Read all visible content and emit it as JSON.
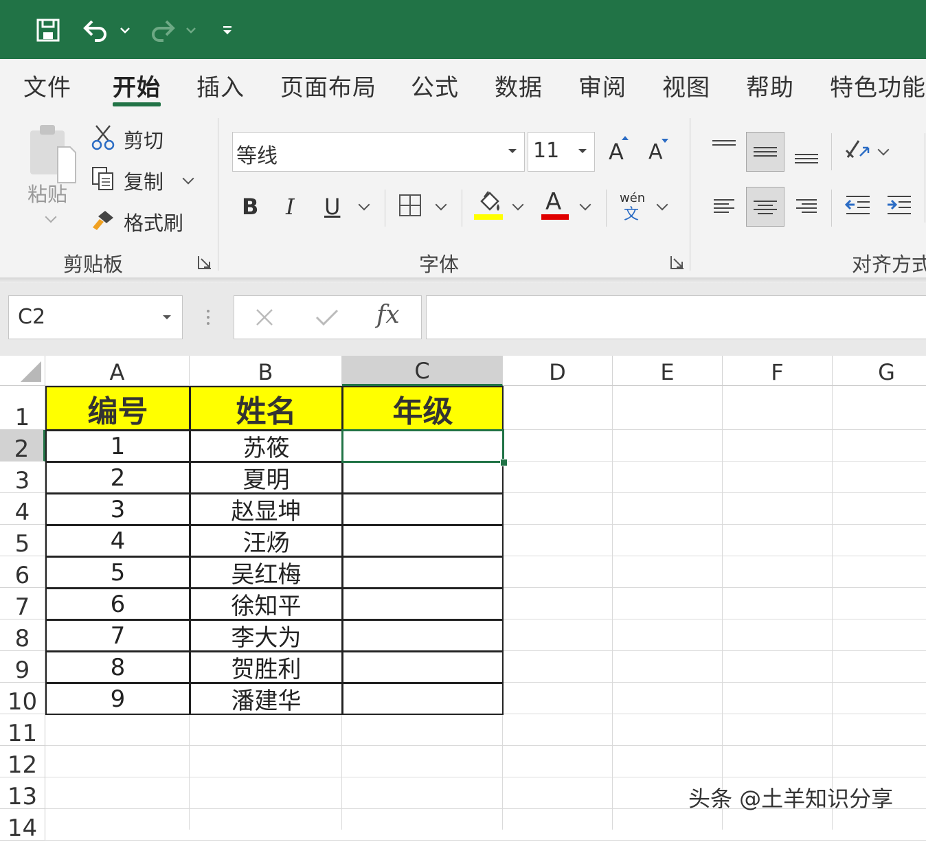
{
  "colors": {
    "brand": "#217346",
    "header_fill": "#ffff00",
    "fill_color_bar": "#ffff00",
    "font_color_bar": "#e00000"
  },
  "quick_access": {
    "icons": [
      "save-icon",
      "undo-icon",
      "redo-icon",
      "customize-icon"
    ]
  },
  "menu": {
    "tabs": [
      "文件",
      "开始",
      "插入",
      "页面布局",
      "公式",
      "数据",
      "审阅",
      "视图",
      "帮助",
      "特色功能"
    ],
    "active": "开始"
  },
  "ribbon": {
    "clipboard": {
      "paste": "粘贴",
      "cut": "剪切",
      "copy": "复制",
      "format_painter": "格式刷",
      "group_label": "剪贴板"
    },
    "font": {
      "font_name": "等线",
      "font_size": "11",
      "bold": "B",
      "italic": "I",
      "underline": "U",
      "grow": "A",
      "shrink": "A",
      "phonetic_top": "wén",
      "phonetic_bottom": "文",
      "font_color": "A",
      "group_label": "字体"
    },
    "alignment": {
      "group_label": "对齐方式"
    }
  },
  "formula_bar": {
    "name_box": "C2",
    "fx": "fx",
    "formula": ""
  },
  "sheet": {
    "columns": [
      "A",
      "B",
      "C",
      "D",
      "E",
      "F",
      "G"
    ],
    "selected_column": "C",
    "rows": [
      "1",
      "2",
      "3",
      "4",
      "5",
      "6",
      "7",
      "8",
      "9",
      "10",
      "11",
      "12",
      "13",
      "14"
    ],
    "selected_row": "2",
    "header": [
      "编号",
      "姓名",
      "年级"
    ],
    "data": [
      [
        "1",
        "苏筱",
        ""
      ],
      [
        "2",
        "夏明",
        ""
      ],
      [
        "3",
        "赵显坤",
        ""
      ],
      [
        "4",
        "汪炀",
        ""
      ],
      [
        "5",
        "吴红梅",
        ""
      ],
      [
        "6",
        "徐知平",
        ""
      ],
      [
        "7",
        "李大为",
        ""
      ],
      [
        "8",
        "贺胜利",
        ""
      ],
      [
        "9",
        "潘建华",
        ""
      ]
    ]
  },
  "watermark": "头条 @土羊知识分享"
}
